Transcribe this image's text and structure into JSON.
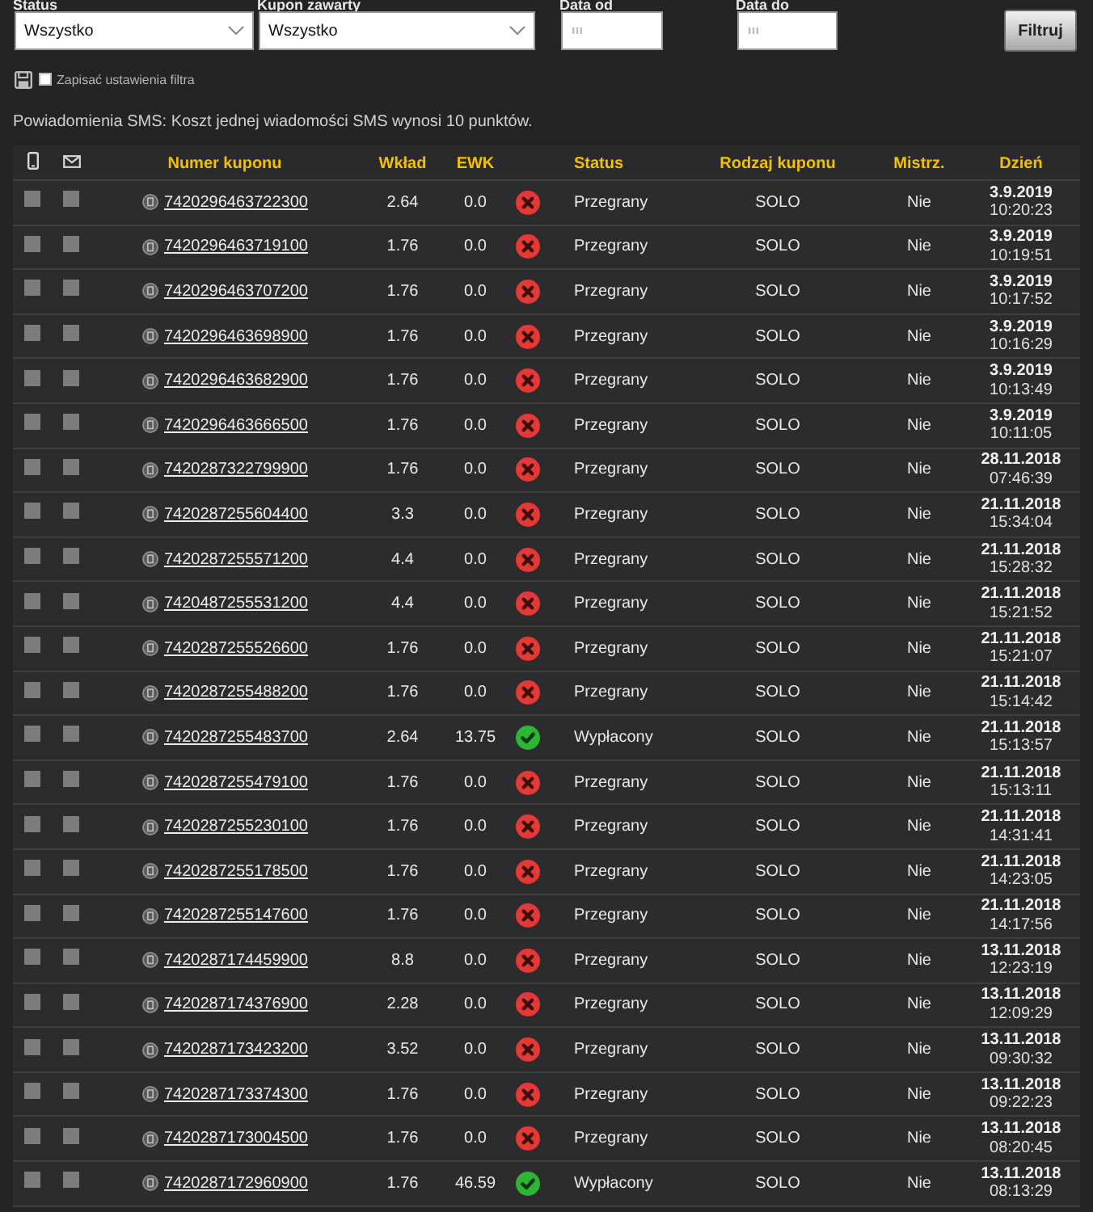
{
  "filters": {
    "status": {
      "label": "Status",
      "value": "Wszystko"
    },
    "coupon_type": {
      "label": "Kupon zawarty",
      "value": "Wszystko"
    },
    "date_from": {
      "label": "Data od"
    },
    "date_to": {
      "label": "Data do"
    },
    "filter_button": "Filtruj",
    "save_settings": {
      "label": "Zapisać ustawienia filtra",
      "checked": false
    }
  },
  "sms_notice": "Powiadomienia SMS: Koszt jednej wiadomości SMS wynosi 10 punktów.",
  "table": {
    "columns": [
      "Numer kuponu",
      "Wkład",
      "EWK",
      "Status",
      "Rodzaj kuponu",
      "Mistrz.",
      "Dzień"
    ],
    "rows": [
      {
        "sms_checked": false,
        "email_checked": false,
        "coupon": "7420296463722300",
        "stake": "2.64",
        "ewk": "0.0",
        "won": false,
        "status": "Przegrany",
        "type": "SOLO",
        "champion": "Nie",
        "date": "3.9.2019",
        "time": "10:20:23"
      },
      {
        "sms_checked": false,
        "email_checked": false,
        "coupon": "7420296463719100",
        "stake": "1.76",
        "ewk": "0.0",
        "won": false,
        "status": "Przegrany",
        "type": "SOLO",
        "champion": "Nie",
        "date": "3.9.2019",
        "time": "10:19:51"
      },
      {
        "sms_checked": false,
        "email_checked": false,
        "coupon": "7420296463707200",
        "stake": "1.76",
        "ewk": "0.0",
        "won": false,
        "status": "Przegrany",
        "type": "SOLO",
        "champion": "Nie",
        "date": "3.9.2019",
        "time": "10:17:52"
      },
      {
        "sms_checked": false,
        "email_checked": false,
        "coupon": "7420296463698900",
        "stake": "1.76",
        "ewk": "0.0",
        "won": false,
        "status": "Przegrany",
        "type": "SOLO",
        "champion": "Nie",
        "date": "3.9.2019",
        "time": "10:16:29"
      },
      {
        "sms_checked": false,
        "email_checked": false,
        "coupon": "7420296463682900",
        "stake": "1.76",
        "ewk": "0.0",
        "won": false,
        "status": "Przegrany",
        "type": "SOLO",
        "champion": "Nie",
        "date": "3.9.2019",
        "time": "10:13:49"
      },
      {
        "sms_checked": false,
        "email_checked": false,
        "coupon": "7420296463666500",
        "stake": "1.76",
        "ewk": "0.0",
        "won": false,
        "status": "Przegrany",
        "type": "SOLO",
        "champion": "Nie",
        "date": "3.9.2019",
        "time": "10:11:05"
      },
      {
        "sms_checked": false,
        "email_checked": false,
        "coupon": "7420287322799900",
        "stake": "1.76",
        "ewk": "0.0",
        "won": false,
        "status": "Przegrany",
        "type": "SOLO",
        "champion": "Nie",
        "date": "28.11.2018",
        "time": "07:46:39"
      },
      {
        "sms_checked": false,
        "email_checked": false,
        "coupon": "7420287255604400",
        "stake": "3.3",
        "ewk": "0.0",
        "won": false,
        "status": "Przegrany",
        "type": "SOLO",
        "champion": "Nie",
        "date": "21.11.2018",
        "time": "15:34:04"
      },
      {
        "sms_checked": false,
        "email_checked": false,
        "coupon": "7420287255571200",
        "stake": "4.4",
        "ewk": "0.0",
        "won": false,
        "status": "Przegrany",
        "type": "SOLO",
        "champion": "Nie",
        "date": "21.11.2018",
        "time": "15:28:32"
      },
      {
        "sms_checked": false,
        "email_checked": false,
        "coupon": "7420487255531200",
        "stake": "4.4",
        "ewk": "0.0",
        "won": false,
        "status": "Przegrany",
        "type": "SOLO",
        "champion": "Nie",
        "date": "21.11.2018",
        "time": "15:21:52"
      },
      {
        "sms_checked": false,
        "email_checked": false,
        "coupon": "7420287255526600",
        "stake": "1.76",
        "ewk": "0.0",
        "won": false,
        "status": "Przegrany",
        "type": "SOLO",
        "champion": "Nie",
        "date": "21.11.2018",
        "time": "15:21:07"
      },
      {
        "sms_checked": false,
        "email_checked": false,
        "coupon": "7420287255488200",
        "stake": "1.76",
        "ewk": "0.0",
        "won": false,
        "status": "Przegrany",
        "type": "SOLO",
        "champion": "Nie",
        "date": "21.11.2018",
        "time": "15:14:42"
      },
      {
        "sms_checked": false,
        "email_checked": false,
        "coupon": "7420287255483700",
        "stake": "2.64",
        "ewk": "13.75",
        "won": true,
        "status": "Wypłacony",
        "type": "SOLO",
        "champion": "Nie",
        "date": "21.11.2018",
        "time": "15:13:57"
      },
      {
        "sms_checked": false,
        "email_checked": false,
        "coupon": "7420287255479100",
        "stake": "1.76",
        "ewk": "0.0",
        "won": false,
        "status": "Przegrany",
        "type": "SOLO",
        "champion": "Nie",
        "date": "21.11.2018",
        "time": "15:13:11"
      },
      {
        "sms_checked": false,
        "email_checked": false,
        "coupon": "7420287255230100",
        "stake": "1.76",
        "ewk": "0.0",
        "won": false,
        "status": "Przegrany",
        "type": "SOLO",
        "champion": "Nie",
        "date": "21.11.2018",
        "time": "14:31:41"
      },
      {
        "sms_checked": false,
        "email_checked": false,
        "coupon": "7420287255178500",
        "stake": "1.76",
        "ewk": "0.0",
        "won": false,
        "status": "Przegrany",
        "type": "SOLO",
        "champion": "Nie",
        "date": "21.11.2018",
        "time": "14:23:05"
      },
      {
        "sms_checked": false,
        "email_checked": false,
        "coupon": "7420287255147600",
        "stake": "1.76",
        "ewk": "0.0",
        "won": false,
        "status": "Przegrany",
        "type": "SOLO",
        "champion": "Nie",
        "date": "21.11.2018",
        "time": "14:17:56"
      },
      {
        "sms_checked": false,
        "email_checked": false,
        "coupon": "7420287174459900",
        "stake": "8.8",
        "ewk": "0.0",
        "won": false,
        "status": "Przegrany",
        "type": "SOLO",
        "champion": "Nie",
        "date": "13.11.2018",
        "time": "12:23:19"
      },
      {
        "sms_checked": false,
        "email_checked": false,
        "coupon": "7420287174376900",
        "stake": "2.28",
        "ewk": "0.0",
        "won": false,
        "status": "Przegrany",
        "type": "SOLO",
        "champion": "Nie",
        "date": "13.11.2018",
        "time": "12:09:29"
      },
      {
        "sms_checked": false,
        "email_checked": false,
        "coupon": "7420287173423200",
        "stake": "3.52",
        "ewk": "0.0",
        "won": false,
        "status": "Przegrany",
        "type": "SOLO",
        "champion": "Nie",
        "date": "13.11.2018",
        "time": "09:30:32"
      },
      {
        "sms_checked": false,
        "email_checked": false,
        "coupon": "7420287173374300",
        "stake": "1.76",
        "ewk": "0.0",
        "won": false,
        "status": "Przegrany",
        "type": "SOLO",
        "champion": "Nie",
        "date": "13.11.2018",
        "time": "09:22:23"
      },
      {
        "sms_checked": false,
        "email_checked": false,
        "coupon": "7420287173004500",
        "stake": "1.76",
        "ewk": "0.0",
        "won": false,
        "status": "Przegrany",
        "type": "SOLO",
        "champion": "Nie",
        "date": "13.11.2018",
        "time": "08:20:45"
      },
      {
        "sms_checked": false,
        "email_checked": false,
        "coupon": "7420287172960900",
        "stake": "1.76",
        "ewk": "46.59",
        "won": true,
        "status": "Wypłacony",
        "type": "SOLO",
        "champion": "Nie",
        "date": "13.11.2018",
        "time": "08:13:29"
      }
    ]
  }
}
